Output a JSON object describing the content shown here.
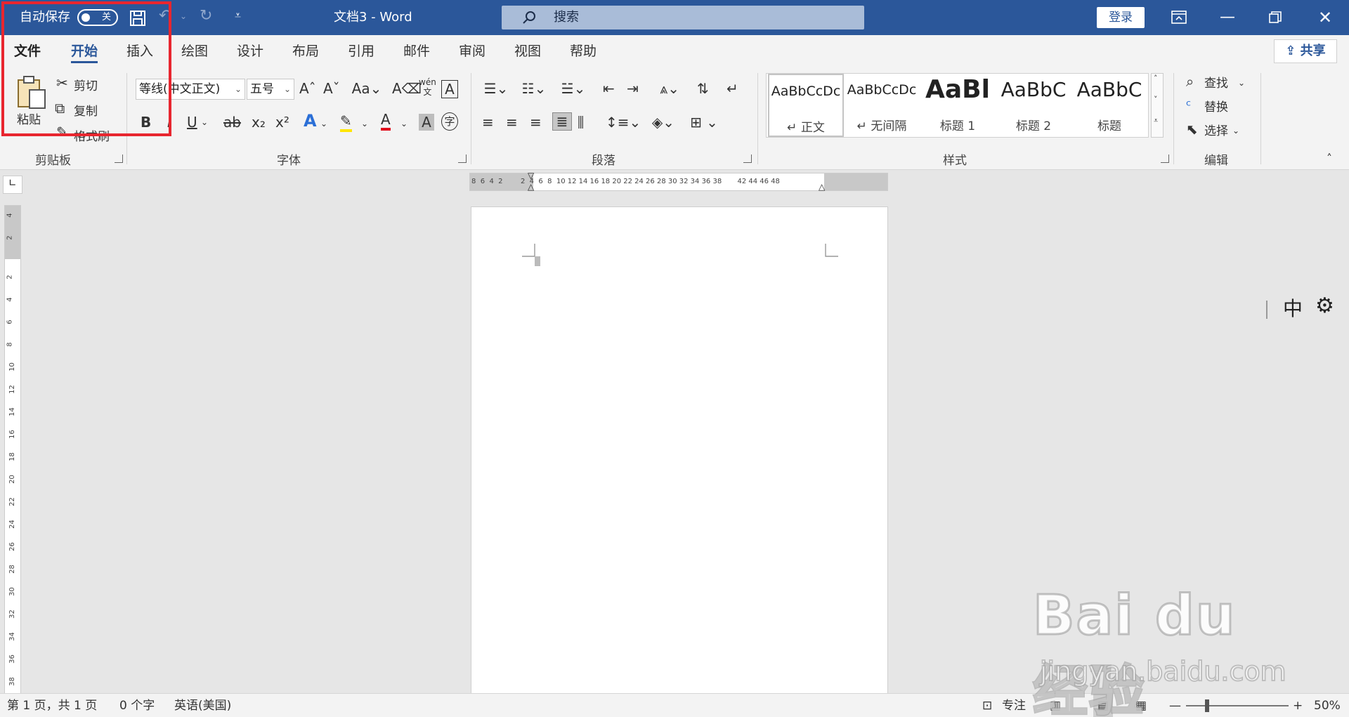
{
  "titlebar": {
    "autosave_label": "自动保存",
    "autosave_state": "关",
    "doc_title": "文档3  -  Word",
    "search_placeholder": "搜索",
    "login_label": "登录"
  },
  "tabs": [
    {
      "label": "文件"
    },
    {
      "label": "开始"
    },
    {
      "label": "插入"
    },
    {
      "label": "绘图"
    },
    {
      "label": "设计"
    },
    {
      "label": "布局"
    },
    {
      "label": "引用"
    },
    {
      "label": "邮件"
    },
    {
      "label": "审阅"
    },
    {
      "label": "视图"
    },
    {
      "label": "帮助"
    }
  ],
  "share_label": "共享",
  "clipboard": {
    "paste": "粘贴",
    "cut": "剪切",
    "copy": "复制",
    "format_painter": "格式刷",
    "group_label": "剪贴板"
  },
  "font": {
    "font_name": "等线",
    "font_script": "(中文正文)",
    "font_size": "五号",
    "group_label": "字体"
  },
  "paragraph": {
    "group_label": "段落"
  },
  "styles": {
    "group_label": "样式",
    "items": [
      {
        "preview": "AaBbCcDc",
        "name": "↵ 正文"
      },
      {
        "preview": "AaBbCcDc",
        "name": "↵ 无间隔"
      },
      {
        "preview": "AaBl",
        "name": "标题 1"
      },
      {
        "preview": "AaBbC",
        "name": "标题 2"
      },
      {
        "preview": "AaBbC",
        "name": "标题"
      }
    ]
  },
  "editing": {
    "find": "查找",
    "replace": "替换",
    "select": "选择",
    "group_label": "编辑"
  },
  "ruler": {
    "h_numbers": "8  6  4  2        2  4  6  8  10 12 14 16 18 20 22 24 26 28 30 32 34 36 38       42 44 46 48",
    "v_numbers": [
      "4",
      "2",
      "2",
      "4",
      "6",
      "8",
      "10",
      "12",
      "14",
      "16",
      "18",
      "20",
      "22",
      "24",
      "26",
      "28",
      "30",
      "32",
      "34",
      "36",
      "38"
    ]
  },
  "ime": {
    "mode": "中"
  },
  "status": {
    "page_info": "第 1 页，共 1 页",
    "word_count": "0 个字",
    "language": "英语(美国)",
    "focus": "专注",
    "zoom": "50%"
  },
  "watermark": {
    "brand": "Bai du 经验",
    "url": "jingyan.baidu.com"
  }
}
